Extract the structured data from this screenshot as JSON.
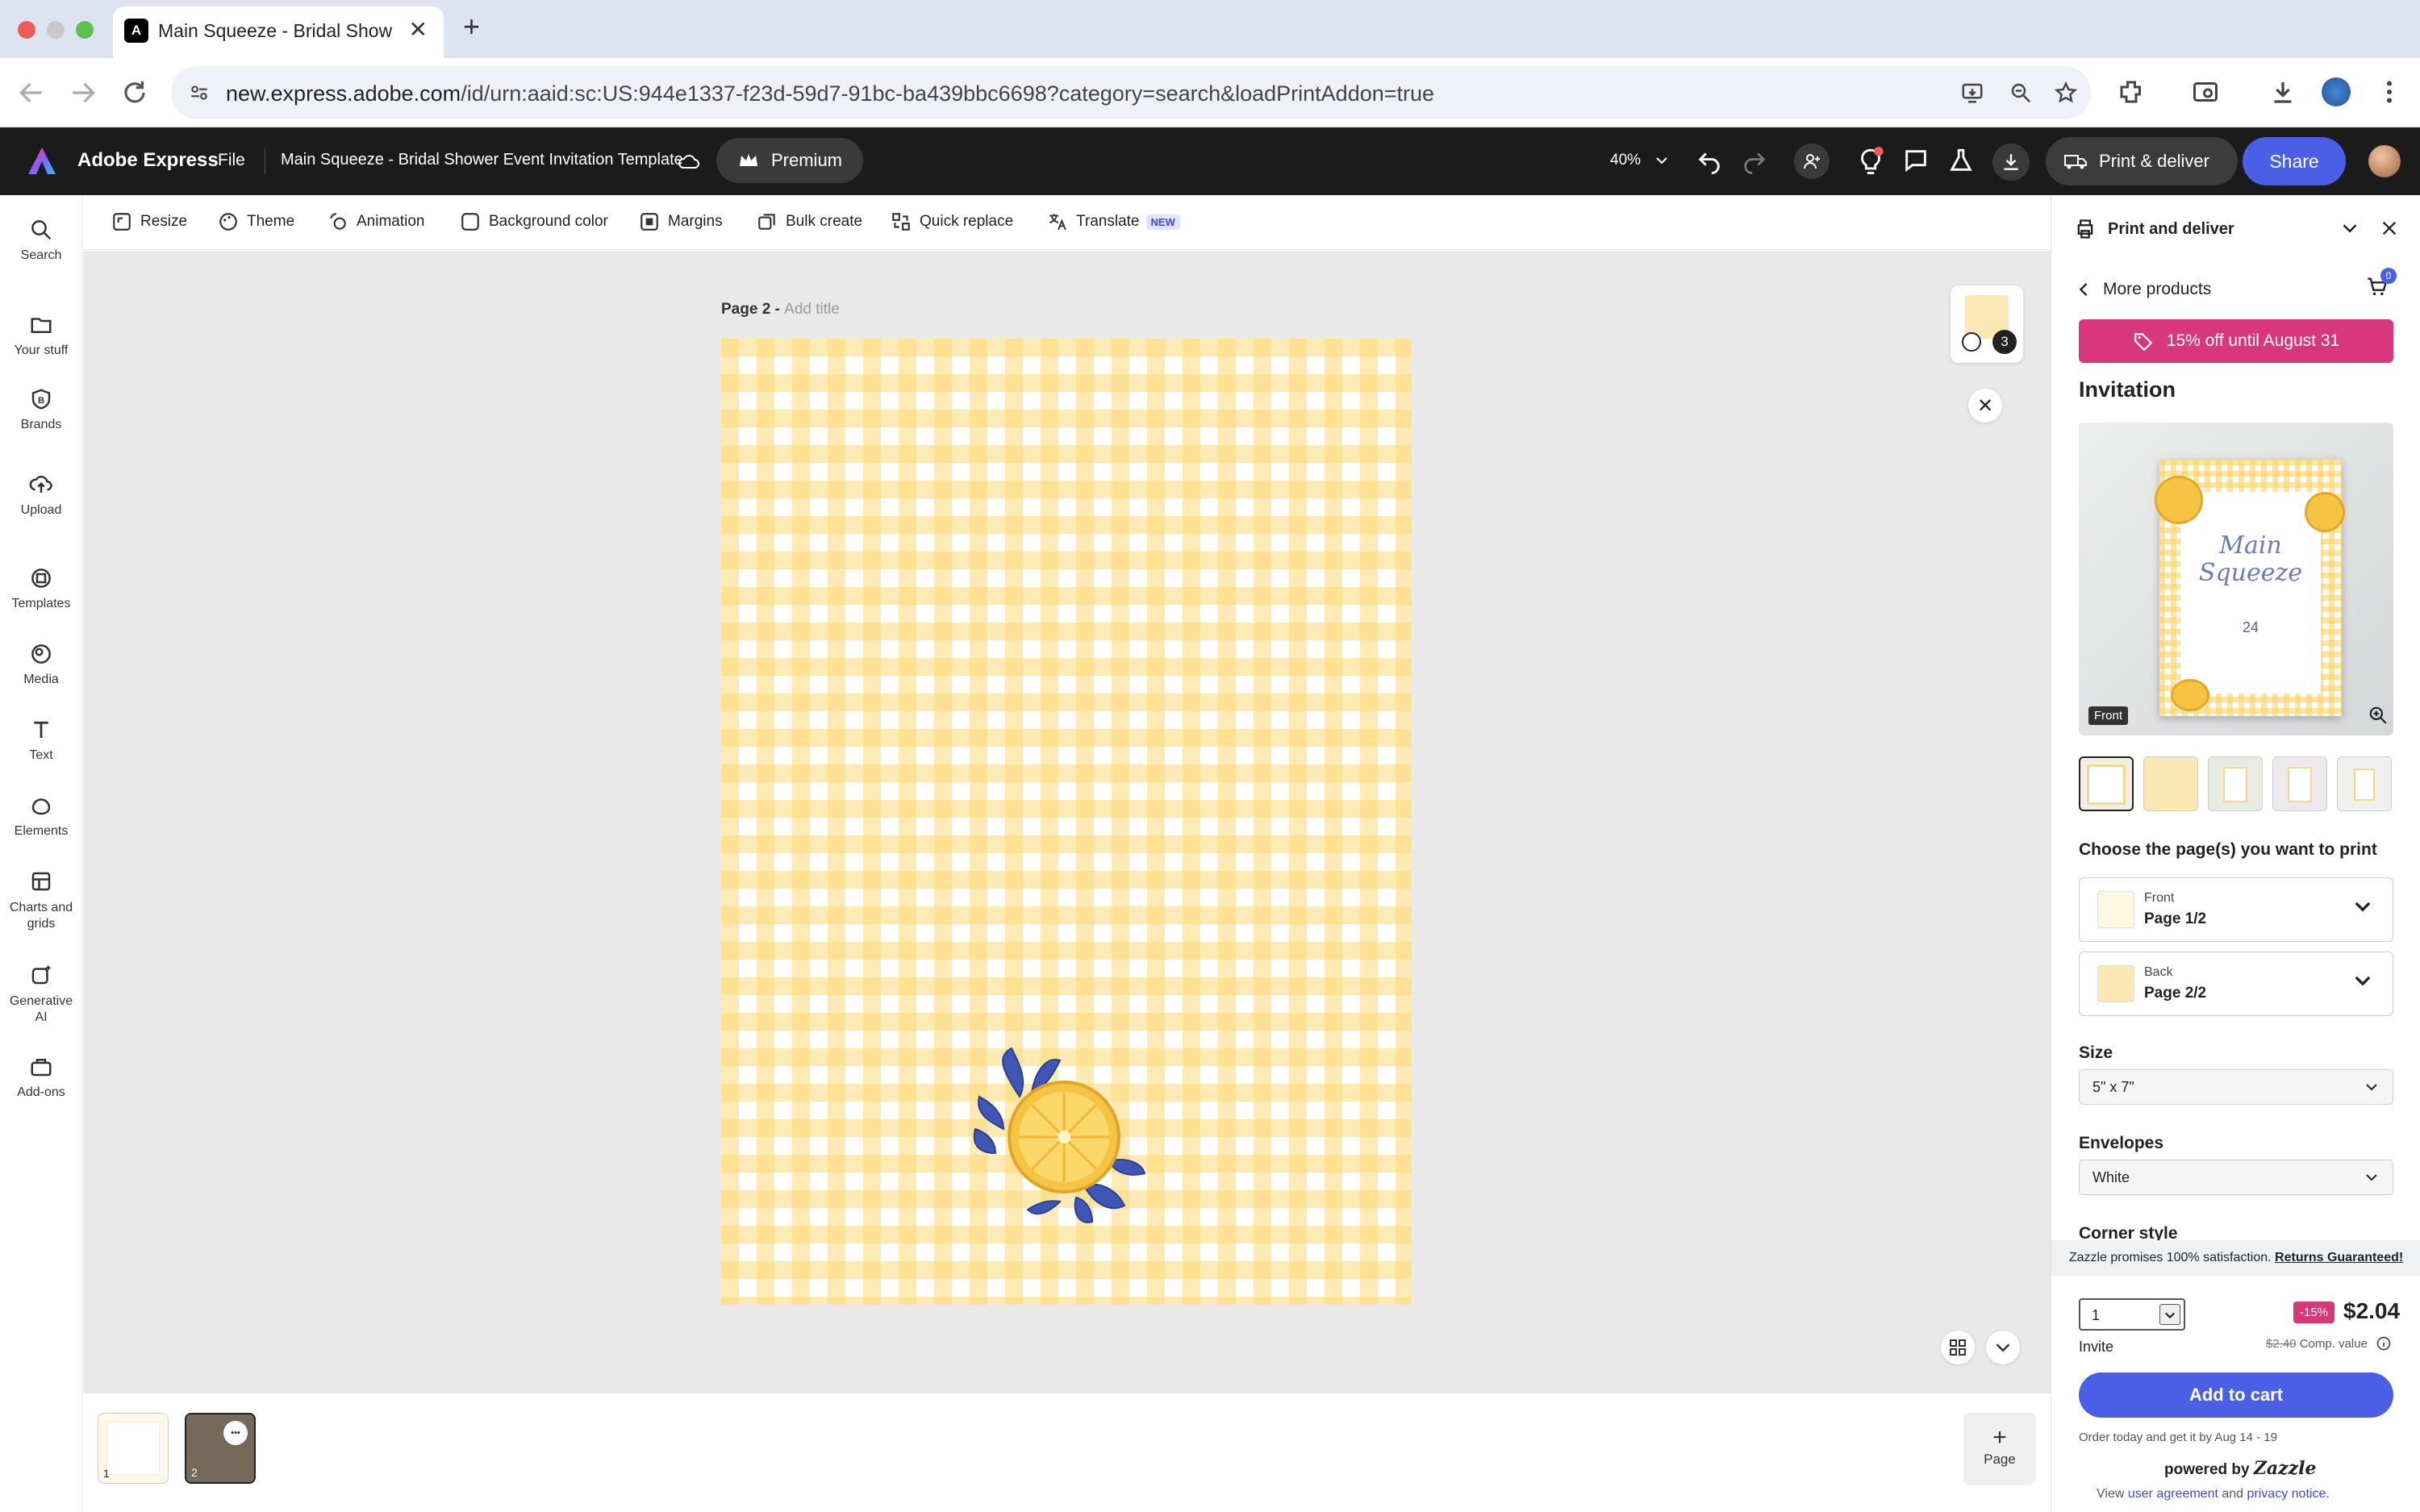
{
  "browser": {
    "tab_title": "Main Squeeze - Bridal Showe",
    "favicon": "A",
    "url_host": "new.express.adobe.com",
    "url_path": "/id/urn:aaid:sc:US:944e1337-f23d-59d7-91bc-ba439bbc6698?category=search&loadPrintAddon=true"
  },
  "appbar": {
    "brand": "Adobe Express",
    "file_menu": "File",
    "doc_title": "Main Squeeze - Bridal Shower Event Invitation Template",
    "premium_label": "Premium",
    "zoom": "40%",
    "print_label": "Print & deliver",
    "share_label": "Share"
  },
  "rail": [
    {
      "label": "Search",
      "icon": "search-icon"
    },
    {
      "label": "Your stuff",
      "icon": "folder-icon"
    },
    {
      "label": "Brands",
      "icon": "brand-icon"
    },
    {
      "label": "Upload",
      "icon": "upload-icon"
    },
    {
      "label": "Templates",
      "icon": "templates-icon"
    },
    {
      "label": "Media",
      "icon": "media-icon"
    },
    {
      "label": "Text",
      "icon": "text-icon"
    },
    {
      "label": "Elements",
      "icon": "elements-icon"
    },
    {
      "label": "Charts and grids",
      "icon": "charts-icon"
    },
    {
      "label": "Generative AI",
      "icon": "generative-ai-icon"
    },
    {
      "label": "Add-ons",
      "icon": "add-ons-icon"
    }
  ],
  "toolbar": {
    "resize": "Resize",
    "theme": "Theme",
    "animation": "Animation",
    "background_color": "Background color",
    "margins": "Margins",
    "bulk_create": "Bulk create",
    "quick_replace": "Quick replace",
    "translate": "Translate",
    "new_badge": "NEW"
  },
  "canvas": {
    "page_label": "Page 2 - ",
    "add_title": "Add title",
    "layer_count": "3"
  },
  "filmstrip": {
    "pages": [
      "1",
      "2"
    ],
    "more": "•••",
    "add_page_label": "Page"
  },
  "print_panel": {
    "header": "Print and deliver",
    "more_products": "More products",
    "cart_count": "0",
    "promo": "15% off until August 31",
    "product_title": "Invitation",
    "preview_side": "Front",
    "preview_title_line1": "Main",
    "preview_title_line2": "Squeeze",
    "preview_date": "24",
    "choose_pages": "Choose the page(s) you want to print",
    "front": {
      "side": "Front",
      "page": "Page 1/2"
    },
    "back": {
      "side": "Back",
      "page": "Page 2/2"
    },
    "size_label": "Size",
    "size_value": "5\" x 7\"",
    "envelopes_label": "Envelopes",
    "envelopes_value": "White",
    "corner_label": "Corner style",
    "guarantee": "Zazzle promises 100% satisfaction.",
    "guarantee_link": "Returns Guaranteed!",
    "quantity": "1",
    "unit": "Invite",
    "discount": "-15%",
    "price": "$2.04",
    "old_price": "$2.40",
    "comp_label": "Comp. value",
    "add_to_cart": "Add to cart",
    "delivery": "Order today and get it by Aug 14 - 19",
    "powered_by": "powered by",
    "powered_brand": "Zazzle",
    "legal_view": "View",
    "legal_user": "user agreement",
    "legal_and": "and",
    "legal_privacy": "privacy notice."
  },
  "colors": {
    "accent": "#4b5ee6",
    "promo": "#d8377c",
    "gingham": "#fdd976",
    "app_bar": "#1b1b1b"
  }
}
